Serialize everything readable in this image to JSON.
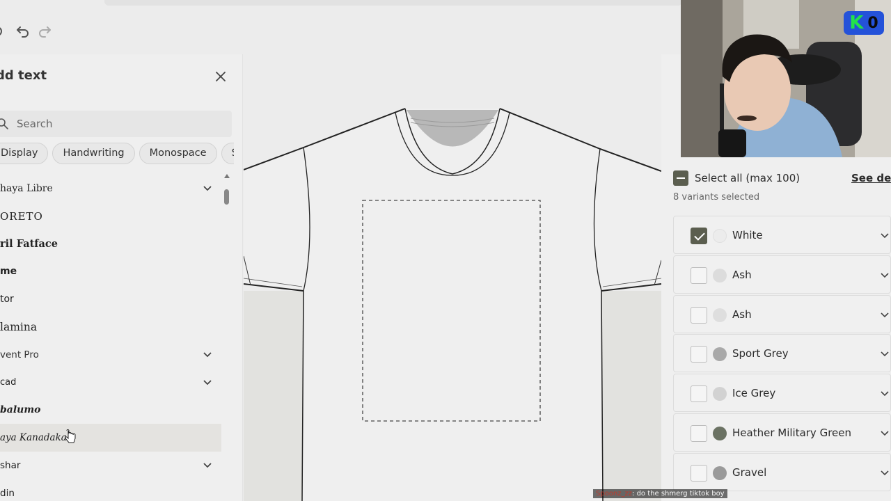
{
  "toolbar": {
    "undo_icon": "undo-icon",
    "redo_icon": "redo-icon"
  },
  "add_text_panel": {
    "title": "dd text",
    "search_placeholder": "Search",
    "chips": [
      "Display",
      "Handwriting",
      "Monospace",
      "S"
    ],
    "fonts": [
      {
        "label": "haya Libre",
        "expandable": true
      },
      {
        "label": "ORETO",
        "expandable": false
      },
      {
        "label": "ril Fatface",
        "expandable": false
      },
      {
        "label": "me",
        "expandable": false
      },
      {
        "label": "tor",
        "expandable": false
      },
      {
        "label": "lamina",
        "expandable": false
      },
      {
        "label": "vent Pro",
        "expandable": true
      },
      {
        "label": "cad",
        "expandable": true
      },
      {
        "label": "balumo",
        "expandable": false
      },
      {
        "label": "aya Kanadaka",
        "expandable": false
      },
      {
        "label": "shar",
        "expandable": true
      },
      {
        "label": "din",
        "expandable": false
      }
    ]
  },
  "variants_panel": {
    "select_all_label": "Select all (max 100)",
    "see_details_label": "See det",
    "variants_count": "8 variants selected",
    "variants": [
      {
        "label": "White",
        "checked": true,
        "swatch": "#ececec"
      },
      {
        "label": "Ash",
        "checked": false,
        "swatch": "#dcdcdc"
      },
      {
        "label": "Ash",
        "checked": false,
        "swatch": "#dedede"
      },
      {
        "label": "Sport Grey",
        "checked": false,
        "swatch": "#a9a9a9"
      },
      {
        "label": "Ice Grey",
        "checked": false,
        "swatch": "#d2d2d2"
      },
      {
        "label": "Heather Military Green",
        "checked": false,
        "swatch": "#6b7263"
      },
      {
        "label": "Gravel",
        "checked": false,
        "swatch": "#9a9a9a"
      }
    ]
  },
  "overlay": {
    "badge_letter": "K",
    "badge_count": "0",
    "caption_user": "Spoonz_zz",
    "caption_text": ": do the shmerg tiktok boy"
  }
}
